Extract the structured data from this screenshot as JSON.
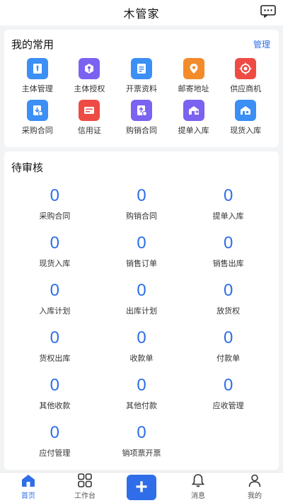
{
  "header": {
    "title": "木管家"
  },
  "favorites": {
    "title": "我的常用",
    "manage_label": "管理",
    "items": [
      {
        "label": "主体管理",
        "icon": "tie-icon",
        "color": "#3b8ff5"
      },
      {
        "label": "主体授权",
        "icon": "key-icon",
        "color": "#7b62f0"
      },
      {
        "label": "开票资料",
        "icon": "document-icon",
        "color": "#3b8ff5"
      },
      {
        "label": "邮寄地址",
        "icon": "location-icon",
        "color": "#f38b2b"
      },
      {
        "label": "供应商机",
        "icon": "target-icon",
        "color": "#ee4b44"
      },
      {
        "label": "采购合同",
        "icon": "download-contract-icon",
        "color": "#3b8ff5"
      },
      {
        "label": "信用证",
        "icon": "card-icon",
        "color": "#ee4b44"
      },
      {
        "label": "购销合同",
        "icon": "upload-contract-icon",
        "color": "#7b62f0"
      },
      {
        "label": "提单入库",
        "icon": "warehouse-icon",
        "color": "#7b62f0"
      },
      {
        "label": "现货入库",
        "icon": "warehouse-spot-icon",
        "color": "#3b8ff5"
      }
    ]
  },
  "pending": {
    "title": "待审核",
    "items": [
      {
        "count": "0",
        "label": "采购合同"
      },
      {
        "count": "0",
        "label": "购销合同"
      },
      {
        "count": "0",
        "label": "提单入库"
      },
      {
        "count": "0",
        "label": "现货入库"
      },
      {
        "count": "0",
        "label": "销售订单"
      },
      {
        "count": "0",
        "label": "销售出库"
      },
      {
        "count": "0",
        "label": "入库计划"
      },
      {
        "count": "0",
        "label": "出库计划"
      },
      {
        "count": "0",
        "label": "放货权"
      },
      {
        "count": "0",
        "label": "货权出库"
      },
      {
        "count": "0",
        "label": "收款单"
      },
      {
        "count": "0",
        "label": "付款单"
      },
      {
        "count": "0",
        "label": "其他收款"
      },
      {
        "count": "0",
        "label": "其他付款"
      },
      {
        "count": "0",
        "label": "应收管理"
      },
      {
        "count": "0",
        "label": "应付管理"
      },
      {
        "count": "0",
        "label": "销项票开票"
      }
    ]
  },
  "tabbar": {
    "home_label": "首页",
    "workbench_label": "工作台",
    "plus_label": "+",
    "messages_label": "消息",
    "mine_label": "我的",
    "accent": "#2f6ee8"
  }
}
